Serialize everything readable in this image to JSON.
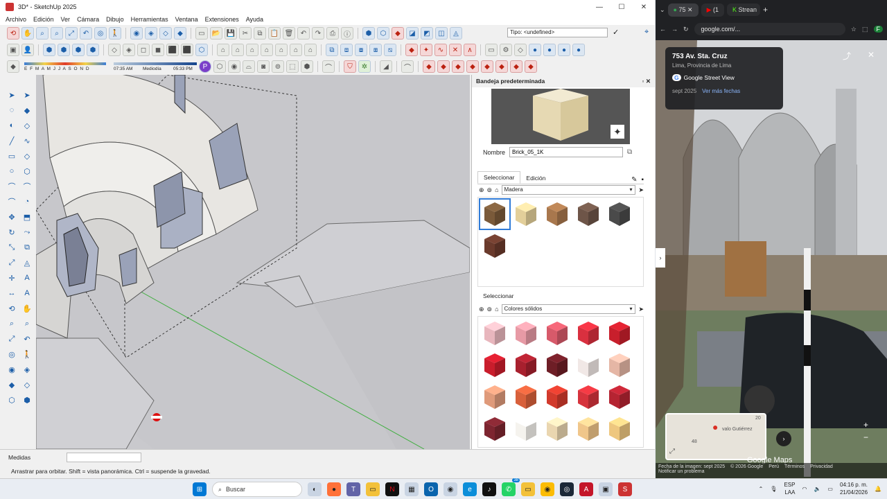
{
  "sketchup": {
    "title": "3D* - SketchUp 2025",
    "menu": [
      "Archivo",
      "Edición",
      "Ver",
      "Cámara",
      "Dibujo",
      "Herramientas",
      "Ventana",
      "Extensiones",
      "Ayuda"
    ],
    "type_field": "Tipo: <undefined>",
    "shadow": {
      "months": "E F M A M J J A S O N D",
      "time_start": "07:35 AM",
      "mid": "Mediodía",
      "time_end": "05:33 PM"
    },
    "tray": {
      "title": "Bandeja predeterminada",
      "name_label": "Nombre",
      "name_value": "Brick_05_1K",
      "tab_select": "Seleccionar",
      "tab_edit": "Edición",
      "library_top": "Madera",
      "select2": "Seleccionar",
      "library_bottom": "Colores sólidos"
    },
    "status": {
      "measure_label": "Medidas",
      "hint": "Arrastrar para orbitar. Shift = vista panorámica. Ctrl = suspende la gravedad."
    },
    "wood_colors": [
      "#7a5a3a",
      "#e3cf9a",
      "#a8774d",
      "#6e5548",
      "#4a4a4a",
      "#6a3a2c"
    ],
    "solid_colors": [
      "#e8b6bd",
      "#e79aa5",
      "#d75a6a",
      "#d9303f",
      "#c81f2c",
      "#c91d2c",
      "#a8202e",
      "#6e1e26",
      "#f1e8e6",
      "#e5b6a5",
      "#df9a7a",
      "#d8603b",
      "#d23a2c",
      "#d6333c",
      "#b52432",
      "#7d2530",
      "#f5f3ee",
      "#ead6b0",
      "#f0c68a",
      "#eec77f"
    ]
  },
  "chrome": {
    "tabs": [
      "75",
      "(1",
      ""
    ],
    "tab_third": "Strean",
    "url": "google.com/...",
    "sv": {
      "address": "753 Av. Sta. Cruz",
      "city": "Lima, Provincia de Lima",
      "label": "Google Street View",
      "date": "sept 2025",
      "more_dates": "Ver más fechas",
      "map_label": "valo Gutiérrez",
      "map_num1": "20",
      "map_num2": "48",
      "footer_date": "Fecha de la imagen: sept 2025",
      "footer_copy": "© 2026 Google",
      "footer_country": "Perú",
      "footer_terms": "Términos",
      "footer_privacy": "Privacidad",
      "footer_report": "Notificar un problema",
      "watermark": "Google Maps"
    }
  },
  "taskbar": {
    "search": "Buscar",
    "lang1": "ESP",
    "lang2": "LAA",
    "time": "04:16 p. m.",
    "date": "21/04/2026",
    "badge": "38"
  }
}
